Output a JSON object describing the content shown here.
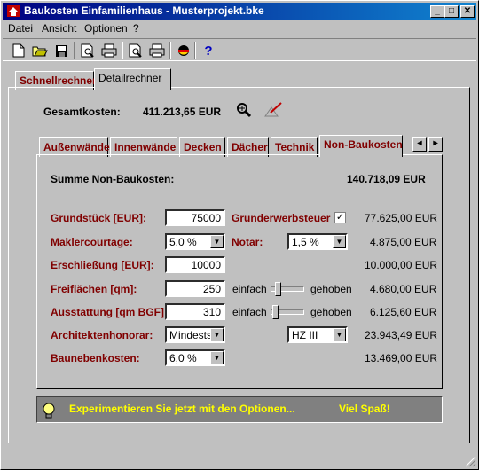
{
  "window": {
    "title": "Baukosten Einfamilienhaus - Musterprojekt.bke"
  },
  "menu": [
    "Datei",
    "Ansicht",
    "Optionen",
    "?"
  ],
  "tabs_main": [
    "Schnellrechner",
    "Detailrechner"
  ],
  "summary": {
    "label": "Gesamtkosten:",
    "value": "411.213,65 EUR"
  },
  "tabs_sub": [
    "Außenwände",
    "Innenwände",
    "Decken",
    "Dächer",
    "Technik",
    "Non-Baukosten"
  ],
  "section": {
    "sum_label": "Summe Non-Baukosten:",
    "sum_value": "140.718,09 EUR"
  },
  "rows": {
    "grundstueck": {
      "label": "Grundstück [EUR]:",
      "value": "75000"
    },
    "grunderwerb": {
      "label": "Grunderwerbsteuer",
      "checked": "✓",
      "amount": "77.625,00 EUR"
    },
    "makler": {
      "label": "Maklercourtage:",
      "select": "5,0 %"
    },
    "notar": {
      "label": "Notar:",
      "select": "1,5 %",
      "amount": "4.875,00 EUR"
    },
    "erschl": {
      "label": "Erschließung [EUR]:",
      "value": "10000",
      "amount": "10.000,00 EUR"
    },
    "frei": {
      "label": "Freiflächen [qm]:",
      "value": "250",
      "low": "einfach",
      "high": "gehoben",
      "amount": "4.680,00 EUR"
    },
    "ausst": {
      "label": "Ausstattung [qm BGF]:",
      "value": "310",
      "low": "einfach",
      "high": "gehoben",
      "amount": "6.125,60 EUR"
    },
    "arch": {
      "label": "Architektenhonorar:",
      "select1": "Mindests",
      "select2": "HZ III",
      "amount": "23.943,49 EUR"
    },
    "bauneb": {
      "label": "Baunebenkosten:",
      "select": "6,0 %",
      "amount": "13.469,00 EUR"
    }
  },
  "hint": {
    "text": "Experimentieren Sie jetzt mit den Optionen...",
    "text2": "Viel Spaß!"
  },
  "slider_levels": {
    "frei": 0.15,
    "ausst": 0.05
  }
}
